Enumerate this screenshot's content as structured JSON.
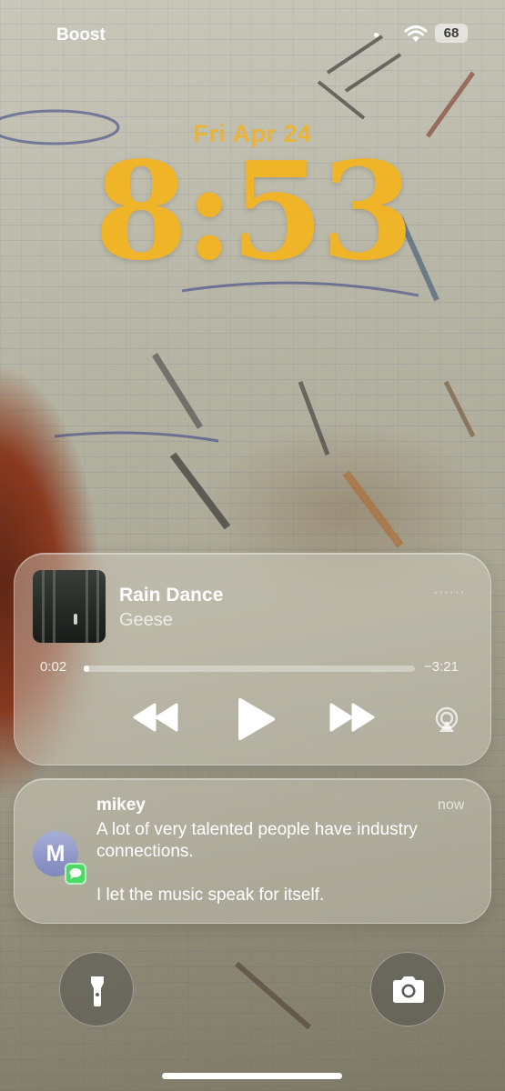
{
  "status_bar": {
    "carrier": "Boost",
    "battery": "68",
    "icons": [
      "signal-dot-icon",
      "wifi-icon",
      "battery-icon"
    ]
  },
  "lock_screen": {
    "date": "Fri Apr 24",
    "time": "8:53",
    "accent_color": "#f0b429"
  },
  "now_playing": {
    "title": "Rain Dance",
    "artist": "Geese",
    "elapsed": "0:02",
    "remaining": "−3:21",
    "progress_fraction": 0.01,
    "controls": [
      "rewind-icon",
      "play-icon",
      "fast-forward-icon",
      "airplay-icon"
    ]
  },
  "notification": {
    "app_icon": "messages-icon",
    "sender": "mikey",
    "avatar_initial": "M",
    "time": "now",
    "lines": [
      "A lot of very talented people have industry connections.",
      "I let the music speak for itself."
    ]
  },
  "quick_actions": {
    "left": "flashlight-icon",
    "right": "camera-icon"
  }
}
